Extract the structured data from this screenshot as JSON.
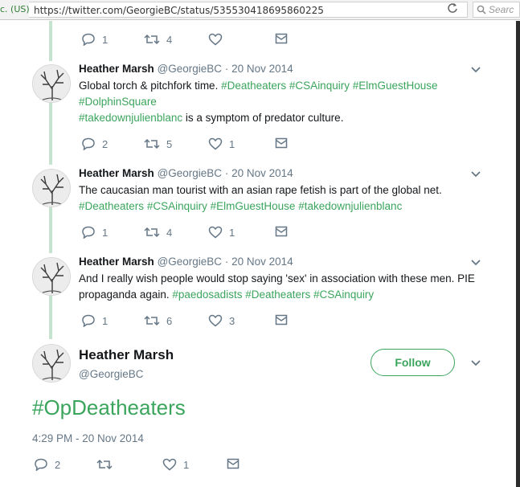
{
  "browser": {
    "secure_label": "c. (US)",
    "url": "https://twitter.com/GeorgieBC/status/535530418695860225",
    "search_placeholder": "Searc"
  },
  "top_actions": {
    "replies": "1",
    "retweets": "4"
  },
  "tweets": [
    {
      "name": "Heather Marsh",
      "handle": "@GeorgieBC",
      "sep": "·",
      "date": "20 Nov 2014",
      "line1": {
        "text": "Global torch & pitchfork time.",
        "tags": [
          "#Deatheaters",
          "#CSAinquiry",
          "#ElmGuestHouse"
        ]
      },
      "line2": {
        "tags": [
          "#DolphinSquare"
        ]
      },
      "line3": {
        "tag": "#takedownjulienblanc",
        "text": "is a symptom of predator culture."
      },
      "replies": "2",
      "retweets": "5",
      "likes": "1"
    },
    {
      "name": "Heather Marsh",
      "handle": "@GeorgieBC",
      "sep": "·",
      "date": "20 Nov 2014",
      "line1": {
        "text": "The caucasian man tourist with an asian rape fetish is part of the global net."
      },
      "line2": {
        "tags": [
          "#Deatheaters",
          "#CSAinquiry",
          "#ElmGuestHouse",
          "#takedownjulienblanc"
        ]
      },
      "replies": "1",
      "retweets": "4",
      "likes": "1"
    },
    {
      "name": "Heather Marsh",
      "handle": "@GeorgieBC",
      "sep": "·",
      "date": "20 Nov 2014",
      "line1": {
        "text": "And I really wish people would stop saying 'sex' in association with these men. PIE"
      },
      "line2": {
        "text": "propaganda again.",
        "tags": [
          "#paedosadists",
          "#Deatheaters",
          "#CSAinquiry"
        ]
      },
      "replies": "1",
      "retweets": "6",
      "likes": "3"
    }
  ],
  "main_tweet": {
    "name": "Heather Marsh",
    "handle": "@GeorgieBC",
    "follow_label": "Follow",
    "text": "#OpDeatheaters",
    "timestamp": "4:29 PM - 20 Nov 2014",
    "replies": "2",
    "likes": "1"
  },
  "colors": {
    "hashtag": "#3ba55d",
    "thread_line": "#c6e3cf",
    "muted": "#657786"
  }
}
